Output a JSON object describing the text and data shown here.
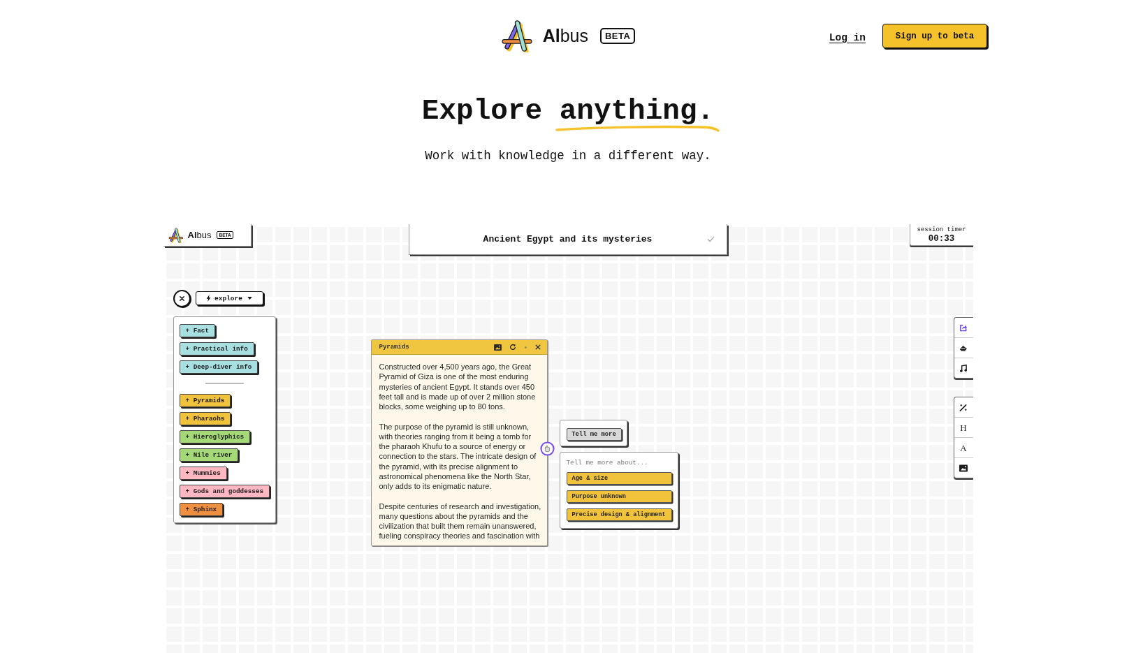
{
  "header": {
    "logo_text": "**Al**bus",
    "badge": "BETA",
    "login": "Log in",
    "signup": "Sign up to beta"
  },
  "hero": {
    "title": "Explore anything.",
    "subtitle": "Work with knowledge in a different way."
  },
  "workspace": {
    "app_logo": {
      "text": "**Al**bus",
      "badge": "BETA"
    },
    "topic": "Ancient Egypt and its mysteries",
    "session_timer": {
      "label": "session timer",
      "time": "00:33"
    },
    "mode_dropdown": "explore",
    "suggestions": {
      "groups": [
        {
          "chips": [
            {
              "label": "+ Fact",
              "color": "#a8dfe0"
            },
            {
              "label": "+ Practical info",
              "color": "#a8dfe0"
            },
            {
              "label": "+ Deep-diver info",
              "color": "#a8dfe0"
            }
          ]
        },
        {
          "chips": [
            {
              "label": "+ Pyramids",
              "color": "#f1c33c"
            },
            {
              "label": "+ Pharaohs",
              "color": "#f1c33c"
            },
            {
              "label": "+ Hieroglyphics",
              "color": "#a5d877"
            },
            {
              "label": "+ Nile river",
              "color": "#a5d877"
            },
            {
              "label": "+ Mummies",
              "color": "#ffb7c1"
            },
            {
              "label": "+ Gods and goddesses",
              "color": "#ffb7c1"
            },
            {
              "label": "+ Sphinx",
              "color": "#ef9040"
            }
          ]
        }
      ]
    },
    "note_card": {
      "title": "Pyramids",
      "paragraphs": [
        "Constructed over 4,500 years ago, the Great Pyramid of Giza is one of the most enduring mysteries of ancient Egypt. It stands over 450 feet tall and is made up of over 2 million stone blocks, some weighing up to 80 tons.",
        "The purpose of the pyramid is still unknown, with theories ranging from it being a tomb for the pharaoh Khufu to a source of energy or connection to the stars. The intricate design of the pyramid, with its precise alignment to astronomical phenomena like the North Star, only adds to its enigmatic nature.",
        "Despite centuries of research and investigation, many questions about the pyramids and the civilization that built them remain unanswered, fueling conspiracy theories and fascination with"
      ]
    },
    "action_button": "Tell me more",
    "followups": {
      "prompt": "Tell me more about...",
      "options": [
        "Age & size",
        "Purpose unknown",
        "Precise design & alignment"
      ]
    },
    "text_tools": [
      "H",
      "A"
    ]
  }
}
